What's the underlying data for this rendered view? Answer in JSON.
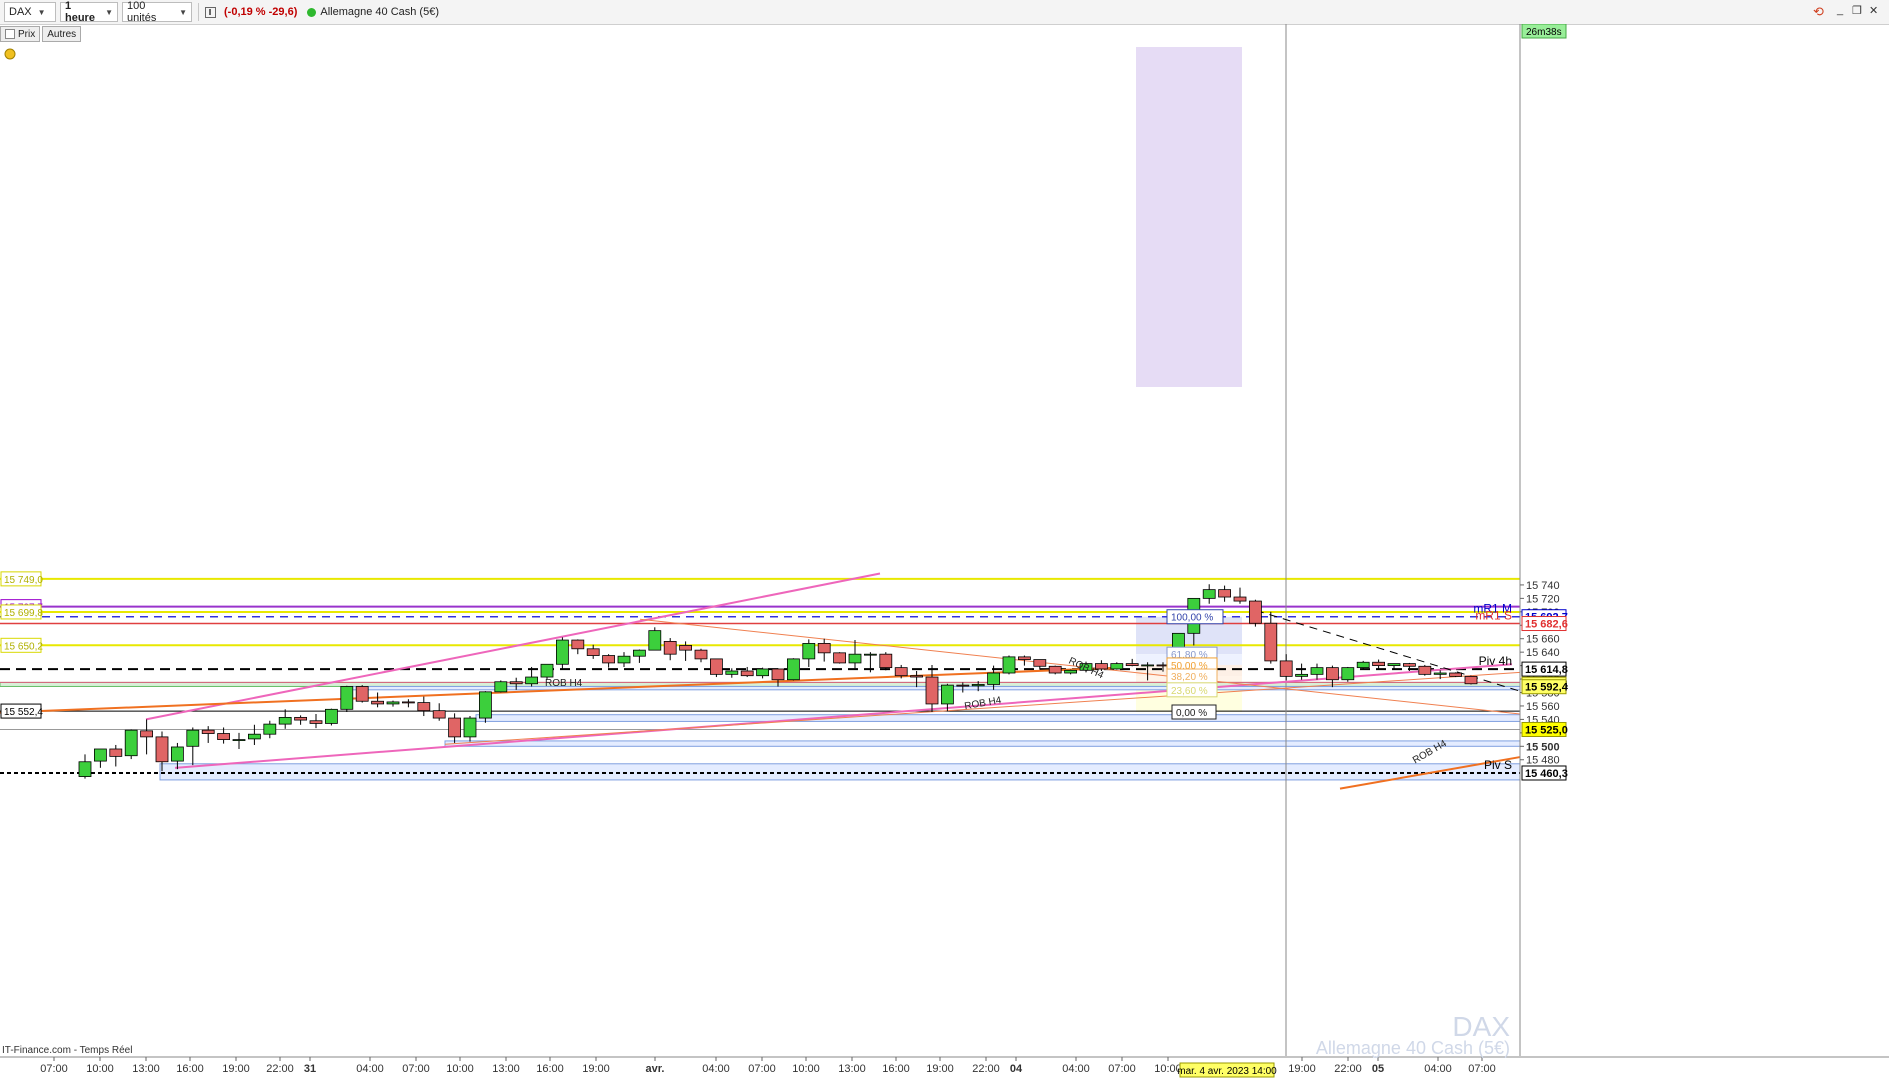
{
  "toolbar": {
    "instrument": "DAX",
    "timeframe": "1 heure",
    "units": "100 unités",
    "change": "(-0,19 % -29,6)",
    "instrument_name": "Allemagne 40 Cash (5€)"
  },
  "subbar": {
    "price_label": "Prix",
    "other_label": "Autres"
  },
  "countdown": "26m38s",
  "footer_source": "IT-Finance.com - Temps Réel",
  "watermark": {
    "symbol": "DAX",
    "name": "Allemagne 40 Cash (5€)"
  },
  "crosshair_date": "mar. 4 avr. 2023 14:00",
  "price_axis": {
    "ticks": [
      "15 740",
      "15 720",
      "15 700",
      "15 680",
      "15 660",
      "15 640",
      "15 620",
      "15 600",
      "15 580",
      "15 560",
      "15 540",
      "15 520",
      "15 500",
      "15 480"
    ],
    "tags": [
      {
        "text": "15 692,7",
        "price": 15692.7,
        "bg": "#ffffff",
        "fg": "#0000cc",
        "border": "#0000cc"
      },
      {
        "text": "15 682,6",
        "price": 15682.6,
        "bg": "#ffffff",
        "fg": "#e03030",
        "border": "#e03030"
      },
      {
        "text": "15 614,8",
        "price": 15614.8,
        "bg": "#ffffff",
        "fg": "#000000",
        "border": "#000000"
      },
      {
        "text": "15 592,4",
        "price": 15592.4,
        "bg": "#ffff66",
        "fg": "#000000",
        "border": "#999900"
      },
      {
        "text": "15 592,4",
        "price": 15588.6,
        "bg": "#ffff66",
        "fg": "#000000",
        "border": "#999900"
      },
      {
        "text": "15 525,0",
        "price": 15525.0,
        "bg": "#ffff00",
        "fg": "#000000",
        "border": "#999900"
      },
      {
        "text": "15 460,3",
        "price": 15460.3,
        "bg": "#ffffff",
        "fg": "#000000",
        "border": "#000000"
      }
    ]
  },
  "left_tags": [
    {
      "text": "15 749,0",
      "price": 15749.0,
      "fg": "#b0b000",
      "border": "#d8d800"
    },
    {
      "text": "15 707,7",
      "price": 15707.7,
      "fg": "#9900cc",
      "border": "#9900cc"
    },
    {
      "text": "15 699,8",
      "price": 15699.8,
      "fg": "#b0b000",
      "border": "#d8d800"
    },
    {
      "text": "15 650,2",
      "price": 15650.2,
      "fg": "#b0b000",
      "border": "#d8d800"
    },
    {
      "text": "15 552,4",
      "price": 15552.4,
      "fg": "#000000",
      "border": "#000000"
    }
  ],
  "line_labels": [
    {
      "text": "mR1 M",
      "price": 15692.7,
      "color": "#0000cc"
    },
    {
      "text": "mR1 S",
      "price": 15682.6,
      "color": "#e03030"
    },
    {
      "text": "Piv 4h",
      "price": 15614.8,
      "color": "#000000"
    },
    {
      "text": "Piv S",
      "price": 15460.3,
      "color": "#000000"
    }
  ],
  "fib_labels": [
    {
      "text": "100,00 %",
      "price": 15692.7,
      "color": "#3344aa"
    },
    {
      "text": "61,80 %",
      "price": 15637.0,
      "color": "#8899cc"
    },
    {
      "text": "50,00 %",
      "price": 15621.0,
      "color": "#f0a030"
    },
    {
      "text": "38,20 %",
      "price": 15604.5,
      "color": "#f0b060"
    },
    {
      "text": "23,60 %",
      "price": 15584.0,
      "color": "#d8d870"
    },
    {
      "text": "0,00 %",
      "price": 15551.0,
      "color": "#222222"
    }
  ],
  "rob_labels": [
    "ROB H4",
    "ROB H4",
    "ROB H4",
    "ROB H4"
  ],
  "x_axis": {
    "labels": [
      {
        "text": "07:00",
        "bold": false
      },
      {
        "text": "10:00",
        "bold": false
      },
      {
        "text": "13:00",
        "bold": false
      },
      {
        "text": "16:00",
        "bold": false
      },
      {
        "text": "19:00",
        "bold": false
      },
      {
        "text": "22:00",
        "bold": false
      },
      {
        "text": "31",
        "bold": true
      },
      {
        "text": "04:00",
        "bold": false
      },
      {
        "text": "07:00",
        "bold": false
      },
      {
        "text": "10:00",
        "bold": false
      },
      {
        "text": "13:00",
        "bold": false
      },
      {
        "text": "16:00",
        "bold": false
      },
      {
        "text": "19:00",
        "bold": false
      },
      {
        "text": "avr.",
        "bold": true
      },
      {
        "text": "04:00",
        "bold": false
      },
      {
        "text": "07:00",
        "bold": false
      },
      {
        "text": "10:00",
        "bold": false
      },
      {
        "text": "13:00",
        "bold": false
      },
      {
        "text": "16:00",
        "bold": false
      },
      {
        "text": "19:00",
        "bold": false
      },
      {
        "text": "22:00",
        "bold": false
      },
      {
        "text": "04",
        "bold": true
      },
      {
        "text": "04:00",
        "bold": false
      },
      {
        "text": "07:00",
        "bold": false
      },
      {
        "text": "10:00",
        "bold": false
      },
      {
        "text": "19:00",
        "bold": false
      },
      {
        "text": "22:00",
        "bold": false
      },
      {
        "text": "05",
        "bold": true
      },
      {
        "text": "04:00",
        "bold": false
      },
      {
        "text": "07:00",
        "bold": false
      }
    ]
  },
  "chart_data": {
    "type": "candlestick",
    "instrument": "DAX",
    "timeframe": "1 heure",
    "ylim": [
      15456,
      15752
    ],
    "candles": [
      {
        "o": 15455,
        "h": 15488,
        "l": 15452,
        "c": 15477
      },
      {
        "o": 15478,
        "h": 15489,
        "l": 15468,
        "c": 15496
      },
      {
        "o": 15496,
        "h": 15502,
        "l": 15470,
        "c": 15485
      },
      {
        "o": 15486,
        "h": 15525,
        "l": 15481,
        "c": 15524
      },
      {
        "o": 15523,
        "h": 15540,
        "l": 15488,
        "c": 15514
      },
      {
        "o": 15514,
        "h": 15522,
        "l": 15463,
        "c": 15477
      },
      {
        "o": 15478,
        "h": 15505,
        "l": 15466,
        "c": 15499
      },
      {
        "o": 15500,
        "h": 15528,
        "l": 15472,
        "c": 15524
      },
      {
        "o": 15524,
        "h": 15530,
        "l": 15505,
        "c": 15519
      },
      {
        "o": 15519,
        "h": 15528,
        "l": 15504,
        "c": 15510
      },
      {
        "o": 15510,
        "h": 15520,
        "l": 15496,
        "c": 15510
      },
      {
        "o": 15511,
        "h": 15532,
        "l": 15502,
        "c": 15518
      },
      {
        "o": 15518,
        "h": 15538,
        "l": 15512,
        "c": 15533
      },
      {
        "o": 15533,
        "h": 15555,
        "l": 15526,
        "c": 15543
      },
      {
        "o": 15543,
        "h": 15546,
        "l": 15532,
        "c": 15539
      },
      {
        "o": 15538,
        "h": 15548,
        "l": 15527,
        "c": 15534
      },
      {
        "o": 15534,
        "h": 15556,
        "l": 15531,
        "c": 15555
      },
      {
        "o": 15555,
        "h": 15590,
        "l": 15551,
        "c": 15589
      },
      {
        "o": 15589,
        "h": 15591,
        "l": 15565,
        "c": 15567
      },
      {
        "o": 15567,
        "h": 15580,
        "l": 15558,
        "c": 15563
      },
      {
        "o": 15563,
        "h": 15568,
        "l": 15559,
        "c": 15566
      },
      {
        "o": 15566,
        "h": 15570,
        "l": 15558,
        "c": 15565
      },
      {
        "o": 15565,
        "h": 15574,
        "l": 15545,
        "c": 15553
      },
      {
        "o": 15553,
        "h": 15564,
        "l": 15538,
        "c": 15542
      },
      {
        "o": 15542,
        "h": 15549,
        "l": 15505,
        "c": 15514
      },
      {
        "o": 15514,
        "h": 15545,
        "l": 15507,
        "c": 15542
      },
      {
        "o": 15542,
        "h": 15582,
        "l": 15535,
        "c": 15581
      },
      {
        "o": 15581,
        "h": 15598,
        "l": 15580,
        "c": 15596
      },
      {
        "o": 15596,
        "h": 15602,
        "l": 15584,
        "c": 15593
      },
      {
        "o": 15593,
        "h": 15618,
        "l": 15589,
        "c": 15603
      },
      {
        "o": 15603,
        "h": 15622,
        "l": 15599,
        "c": 15622
      },
      {
        "o": 15622,
        "h": 15662,
        "l": 15614,
        "c": 15658
      },
      {
        "o": 15658,
        "h": 15659,
        "l": 15637,
        "c": 15645
      },
      {
        "o": 15645,
        "h": 15651,
        "l": 15630,
        "c": 15635
      },
      {
        "o": 15635,
        "h": 15637,
        "l": 15617,
        "c": 15624
      },
      {
        "o": 15624,
        "h": 15640,
        "l": 15618,
        "c": 15634
      },
      {
        "o": 15634,
        "h": 15644,
        "l": 15624,
        "c": 15643
      },
      {
        "o": 15643,
        "h": 15677,
        "l": 15656,
        "c": 15672
      },
      {
        "o": 15656,
        "h": 15661,
        "l": 15628,
        "c": 15637
      },
      {
        "o": 15650,
        "h": 15656,
        "l": 15627,
        "c": 15643
      },
      {
        "o": 15643,
        "h": 15645,
        "l": 15625,
        "c": 15630
      },
      {
        "o": 15630,
        "h": 15628,
        "l": 15603,
        "c": 15607
      },
      {
        "o": 15607,
        "h": 15616,
        "l": 15602,
        "c": 15612
      },
      {
        "o": 15612,
        "h": 15618,
        "l": 15603,
        "c": 15605
      },
      {
        "o": 15605,
        "h": 15617,
        "l": 15601,
        "c": 15615
      },
      {
        "o": 15615,
        "h": 15616,
        "l": 15589,
        "c": 15599
      },
      {
        "o": 15599,
        "h": 15631,
        "l": 15598,
        "c": 15630
      },
      {
        "o": 15630,
        "h": 15659,
        "l": 15618,
        "c": 15653
      },
      {
        "o": 15653,
        "h": 15660,
        "l": 15626,
        "c": 15639
      },
      {
        "o": 15639,
        "h": 15640,
        "l": 15623,
        "c": 15624
      },
      {
        "o": 15624,
        "h": 15658,
        "l": 15616,
        "c": 15637
      },
      {
        "o": 15637,
        "h": 15640,
        "l": 15610,
        "c": 15637
      },
      {
        "o": 15637,
        "h": 15640,
        "l": 15613,
        "c": 15617
      },
      {
        "o": 15617,
        "h": 15621,
        "l": 15601,
        "c": 15605
      },
      {
        "o": 15605,
        "h": 15612,
        "l": 15588,
        "c": 15603
      },
      {
        "o": 15603,
        "h": 15621,
        "l": 15551,
        "c": 15563
      },
      {
        "o": 15563,
        "h": 15593,
        "l": 15552,
        "c": 15591
      },
      {
        "o": 15591,
        "h": 15595,
        "l": 15580,
        "c": 15590
      },
      {
        "o": 15590,
        "h": 15597,
        "l": 15582,
        "c": 15592
      },
      {
        "o": 15592,
        "h": 15620,
        "l": 15584,
        "c": 15609
      },
      {
        "o": 15609,
        "h": 15635,
        "l": 15607,
        "c": 15633
      },
      {
        "o": 15633,
        "h": 15635,
        "l": 15620,
        "c": 15629
      },
      {
        "o": 15629,
        "h": 15629,
        "l": 15614,
        "c": 15619
      },
      {
        "o": 15619,
        "h": 15620,
        "l": 15607,
        "c": 15609
      },
      {
        "o": 15609,
        "h": 15614,
        "l": 15607,
        "c": 15613
      },
      {
        "o": 15613,
        "h": 15626,
        "l": 15610,
        "c": 15623
      },
      {
        "o": 15623,
        "h": 15628,
        "l": 15612,
        "c": 15615
      },
      {
        "o": 15615,
        "h": 15625,
        "l": 15614,
        "c": 15623
      },
      {
        "o": 15623,
        "h": 15630,
        "l": 15619,
        "c": 15620
      },
      {
        "o": 15620,
        "h": 15625,
        "l": 15598,
        "c": 15621
      },
      {
        "o": 15621,
        "h": 15625,
        "l": 15611,
        "c": 15620
      },
      {
        "o": 15620,
        "h": 15668,
        "l": 15618,
        "c": 15668
      },
      {
        "o": 15668,
        "h": 15692,
        "l": 15650,
        "c": 15720
      },
      {
        "o": 15720,
        "h": 15741,
        "l": 15712,
        "c": 15733
      },
      {
        "o": 15733,
        "h": 15739,
        "l": 15715,
        "c": 15722
      },
      {
        "o": 15722,
        "h": 15736,
        "l": 15712,
        "c": 15716
      },
      {
        "o": 15716,
        "h": 15718,
        "l": 15678,
        "c": 15683
      },
      {
        "o": 15683,
        "h": 15700,
        "l": 15623,
        "c": 15627
      },
      {
        "o": 15627,
        "h": 15637,
        "l": 15598,
        "c": 15604
      },
      {
        "o": 15604,
        "h": 15623,
        "l": 15599,
        "c": 15607
      },
      {
        "o": 15607,
        "h": 15623,
        "l": 15599,
        "c": 15617
      },
      {
        "o": 15617,
        "h": 15620,
        "l": 15588,
        "c": 15599
      },
      {
        "o": 15599,
        "h": 15618,
        "l": 15596,
        "c": 15617
      },
      {
        "o": 15617,
        "h": 15627,
        "l": 15614,
        "c": 15625
      },
      {
        "o": 15625,
        "h": 15629,
        "l": 15614,
        "c": 15620
      },
      {
        "o": 15620,
        "h": 15623,
        "l": 15615,
        "c": 15623
      },
      {
        "o": 15623,
        "h": 15624,
        "l": 15612,
        "c": 15619
      },
      {
        "o": 15619,
        "h": 15621,
        "l": 15605,
        "c": 15607
      },
      {
        "o": 15607,
        "h": 15613,
        "l": 15600,
        "c": 15609
      },
      {
        "o": 15609,
        "h": 15610,
        "l": 15603,
        "c": 15604
      },
      {
        "o": 15604,
        "h": 15603,
        "l": 15592,
        "c": 15593
      }
    ]
  }
}
